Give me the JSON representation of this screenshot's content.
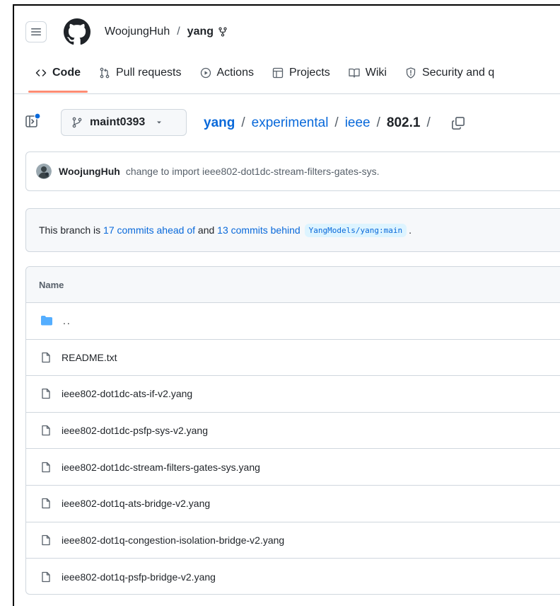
{
  "header": {
    "owner": "WoojungHuh",
    "separator": "/",
    "repo": "yang"
  },
  "nav": {
    "tabs": [
      {
        "label": "Code",
        "icon": "code-icon"
      },
      {
        "label": "Pull requests",
        "icon": "pull-request-icon"
      },
      {
        "label": "Actions",
        "icon": "play-icon"
      },
      {
        "label": "Projects",
        "icon": "table-icon"
      },
      {
        "label": "Wiki",
        "icon": "book-icon"
      },
      {
        "label": "Security and q",
        "icon": "shield-icon"
      }
    ]
  },
  "toolbar": {
    "branch": "maint0393",
    "breadcrumb": {
      "repo": "yang",
      "sep": "/",
      "dir1": "experimental",
      "dir2": "ieee",
      "current": "802.1",
      "trailing_sep": "/"
    }
  },
  "commit": {
    "author": "WoojungHuh",
    "message": "change to import ieee802-dot1dc-stream-filters-gates-sys."
  },
  "branch_info": {
    "prefix": "This branch is",
    "ahead": "17 commits ahead of",
    "and": "and",
    "behind": "13 commits behind",
    "upstream": "YangModels/yang:main",
    "suffix": "."
  },
  "files": {
    "column_name": "Name",
    "parent": "..",
    "items": [
      "README.txt",
      "ieee802-dot1dc-ats-if-v2.yang",
      "ieee802-dot1dc-psfp-sys-v2.yang",
      "ieee802-dot1dc-stream-filters-gates-sys.yang",
      "ieee802-dot1q-ats-bridge-v2.yang",
      "ieee802-dot1q-congestion-isolation-bridge-v2.yang",
      "ieee802-dot1q-psfp-bridge-v2.yang"
    ]
  },
  "colors": {
    "link": "#0969da",
    "tab_underline": "#fd8c73",
    "border": "#d0d7de",
    "folder": "#54aeff",
    "notification_dot": "#0969da"
  }
}
